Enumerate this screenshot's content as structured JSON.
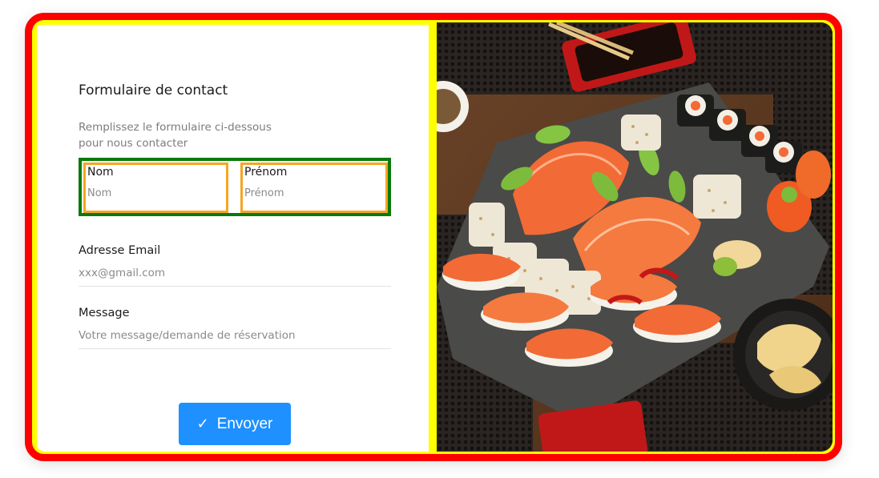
{
  "form": {
    "title": "Formulaire de contact",
    "subtitle": "Remplissez le formulaire ci-dessous pour nous contacter",
    "fields": {
      "last_name": {
        "label": "Nom",
        "placeholder": "Nom",
        "value": ""
      },
      "first_name": {
        "label": "Prénom",
        "placeholder": "Prénom",
        "value": ""
      },
      "email": {
        "label": "Adresse Email",
        "placeholder": "xxx@gmail.com",
        "value": ""
      },
      "message": {
        "label": "Message",
        "placeholder": "Votre message/demande de réservation",
        "value": ""
      }
    },
    "submit": {
      "icon": "check-icon",
      "label": "Envoyer"
    }
  },
  "image": {
    "subject": "sushi-platter-photo"
  },
  "colors": {
    "outer_border": "#ff0000",
    "inner_border": "#ffff00",
    "name_row_border": "#0a7a0a",
    "name_field_border": "#f5a623",
    "button": "#1e90ff"
  }
}
